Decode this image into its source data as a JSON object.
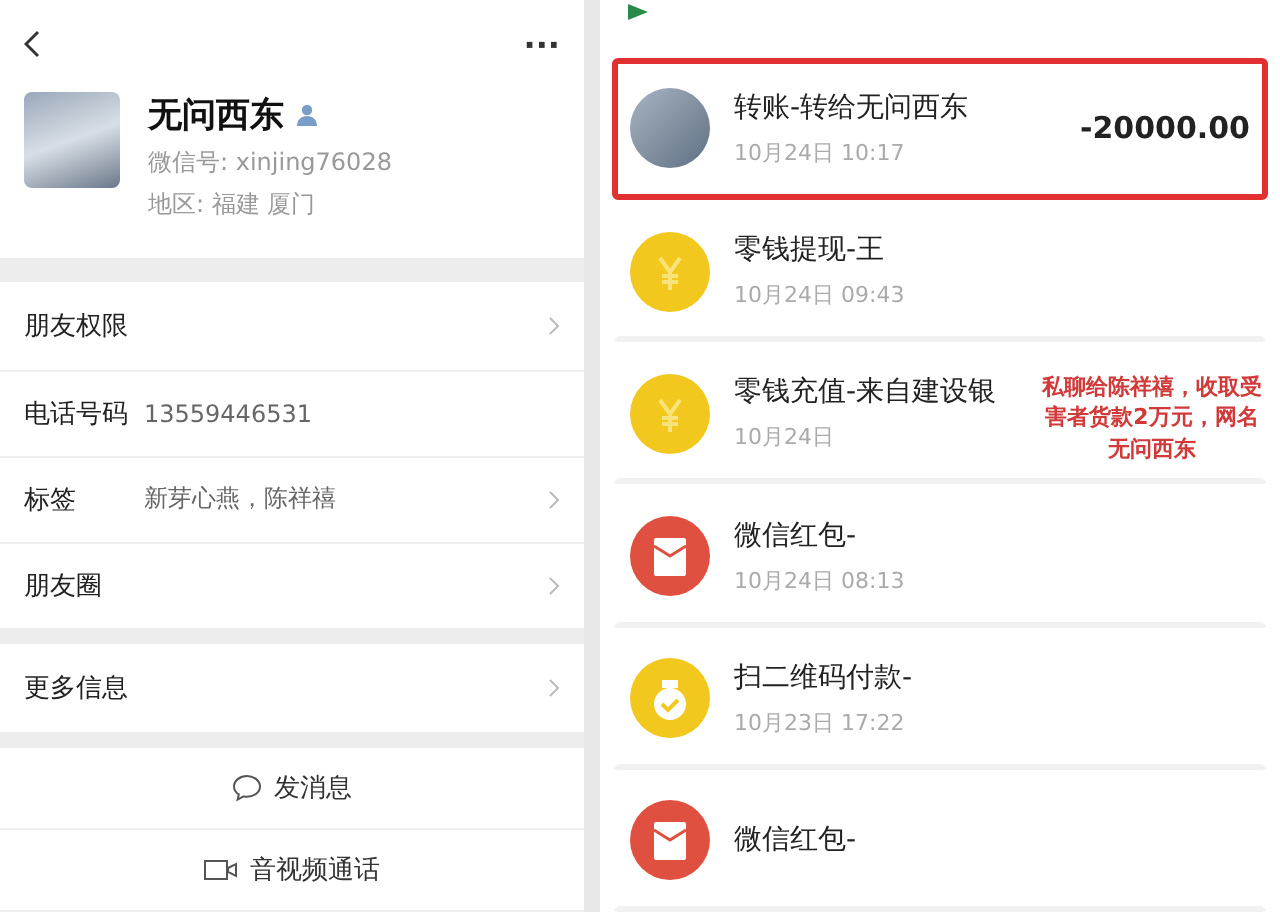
{
  "profile": {
    "name": "无问西东",
    "wechat_id": "微信号: xinjing76028",
    "region": "地区: 福建  厦门",
    "more": "···"
  },
  "rows": [
    {
      "label": "朋友权限",
      "chevron": true,
      "gap_after": false
    },
    {
      "label": "电话号码",
      "value": "13559446531",
      "chevron": false,
      "gap_after": false
    },
    {
      "label": "标签",
      "value": "新芽心燕，陈祥禧",
      "chevron": true,
      "gap_after": false
    },
    {
      "label": "朋友圈",
      "chevron": true,
      "gap_after": true
    },
    {
      "label": "更多信息",
      "chevron": true,
      "gap_after": true
    }
  ],
  "actions": [
    {
      "kind": "message",
      "label": "发消息"
    },
    {
      "kind": "call",
      "label": "音视频通话"
    }
  ],
  "transactions": [
    {
      "kind": "avatar",
      "title": "转账-转给无问西东",
      "time": "10月24日 10:17",
      "amount": "-20000.00",
      "highlighted": true
    },
    {
      "kind": "coin",
      "title": "零钱提现-王",
      "time": "10月24日 09:43",
      "highlighted": false
    },
    {
      "kind": "coin",
      "title": "零钱充值-来自建设银",
      "time": "10月24日",
      "highlighted": false
    },
    {
      "kind": "redpacket",
      "title": "微信红包-",
      "time": "10月24日 08:13",
      "highlighted": false
    },
    {
      "kind": "qr",
      "title": "扫二维码付款-",
      "time": "10月23日 17:22",
      "highlighted": false
    },
    {
      "kind": "redpacket",
      "title": "微信红包-",
      "highlighted": false
    }
  ],
  "annotation": "私聊给陈祥禧，收取受害者货款2万元，网名无问西东"
}
